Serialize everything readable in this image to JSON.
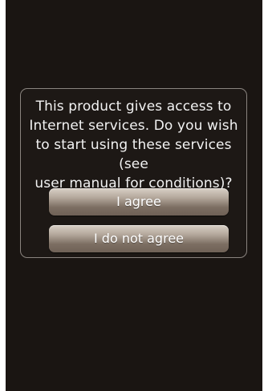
{
  "dialog": {
    "message": "This product gives access to\nInternet services. Do you wish\nto start using these services (see\nuser manual for conditions)?",
    "agree_label": "I agree",
    "disagree_label": "I do not agree"
  }
}
